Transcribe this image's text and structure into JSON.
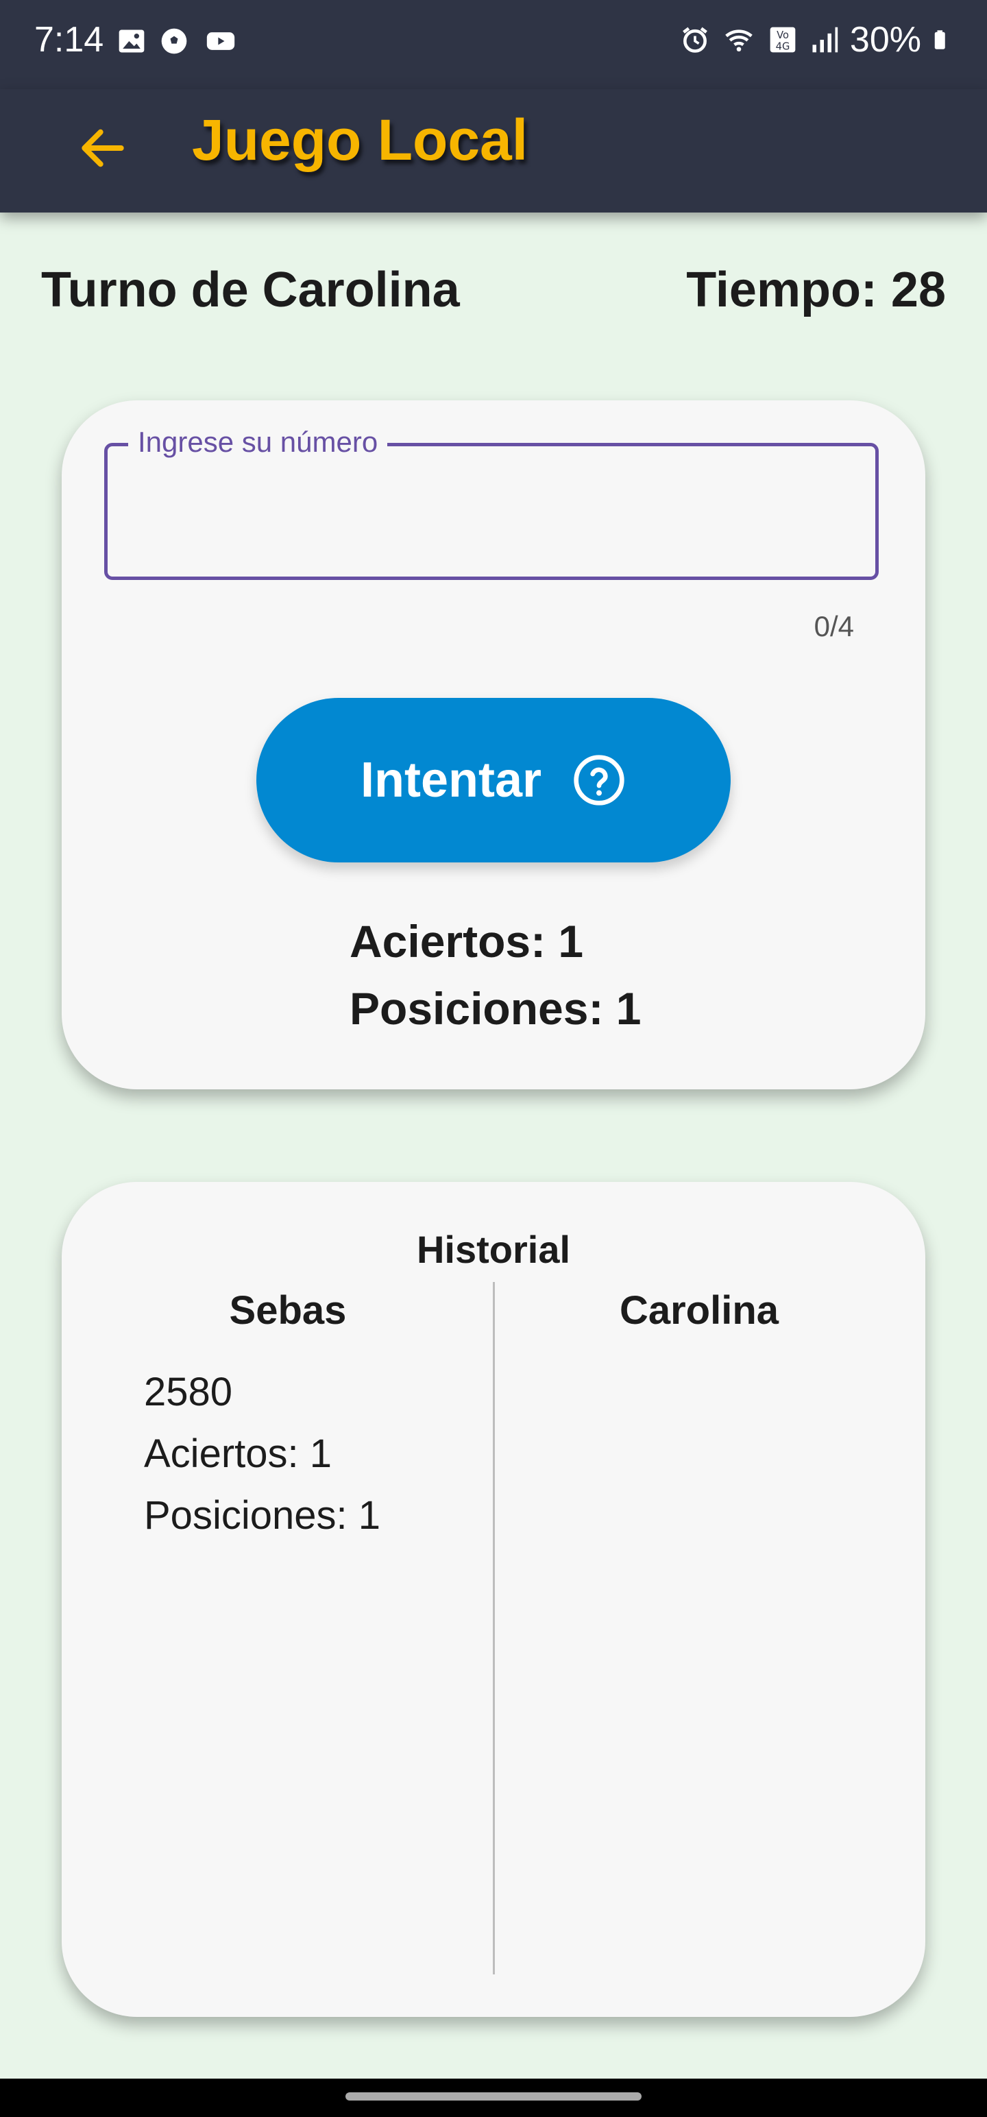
{
  "status": {
    "time": "7:14",
    "battery": "30%",
    "left_icons": [
      "image-icon",
      "soccer-ball-icon",
      "youtube-icon"
    ],
    "right_icons": [
      "alarm-icon",
      "wifi-icon",
      "volte-icon",
      "signal-icon",
      "battery-icon"
    ]
  },
  "appbar": {
    "title": "Juego Local",
    "accent": "#f7b500",
    "background": "#2f3445"
  },
  "game": {
    "turn": "Turno de Carolina",
    "time": "Tiempo: 28"
  },
  "input": {
    "label": "Ingrese su número",
    "value": "",
    "counter": "0/4"
  },
  "try_button": {
    "label": "Intentar",
    "color": "#0288d1"
  },
  "result": {
    "aciertos": "Aciertos: 1",
    "posiciones": "Posiciones: 1"
  },
  "history": {
    "title": "Historial",
    "players": [
      {
        "name": "Sebas",
        "entries": [
          {
            "guess": "2580",
            "aciertos": "Aciertos: 1",
            "posiciones": "Posiciones: 1"
          }
        ]
      },
      {
        "name": "Carolina",
        "entries": []
      }
    ]
  }
}
